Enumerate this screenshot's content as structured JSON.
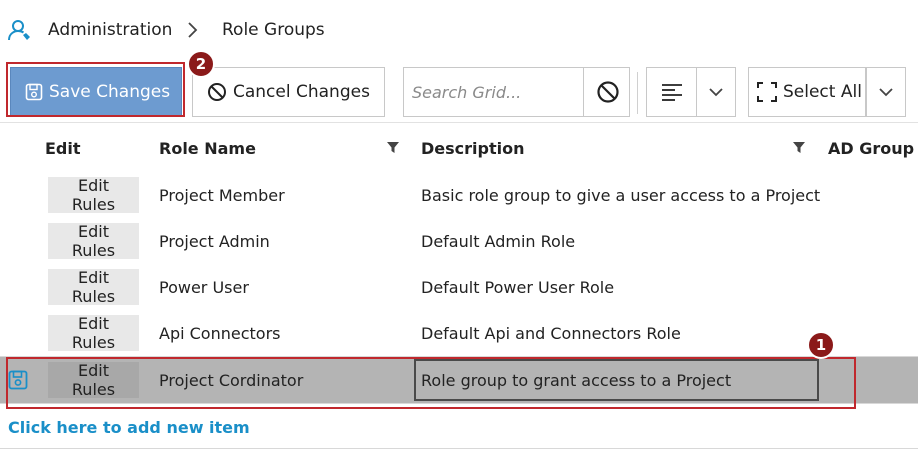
{
  "breadcrumb": {
    "icon": "user-roles-icon",
    "items": [
      "Administration",
      "Role Groups"
    ]
  },
  "toolbar": {
    "save_label": "Save Changes",
    "cancel_label": "Cancel Changes",
    "search_placeholder": "Search Grid...",
    "select_all_label": "Select All"
  },
  "grid": {
    "columns": [
      "Edit",
      "Role Name",
      "Description",
      "AD Group"
    ],
    "rows": [
      {
        "edit": "Edit Rules",
        "role_name": "Project Member",
        "description": "Basic role group to give a user access to a Project"
      },
      {
        "edit": "Edit Rules",
        "role_name": "Project Admin",
        "description": "Default Admin Role"
      },
      {
        "edit": "Edit Rules",
        "role_name": "Power User",
        "description": "Default Power User Role"
      },
      {
        "edit": "Edit Rules",
        "role_name": "Api Connectors",
        "description": "Default Api and Connectors Role"
      },
      {
        "edit": "Edit Rules",
        "role_name": "Project Cordinator",
        "description": "Role group to grant access to a Project"
      }
    ],
    "add_new_label": "Click here to add new item"
  },
  "callouts": [
    "1",
    "2"
  ],
  "colors": {
    "accent": "#6d9bd0",
    "callout": "#c0282d",
    "badge": "#8b1a1a",
    "link": "#1a8fc8",
    "selected_row": "#b4b4b4"
  }
}
